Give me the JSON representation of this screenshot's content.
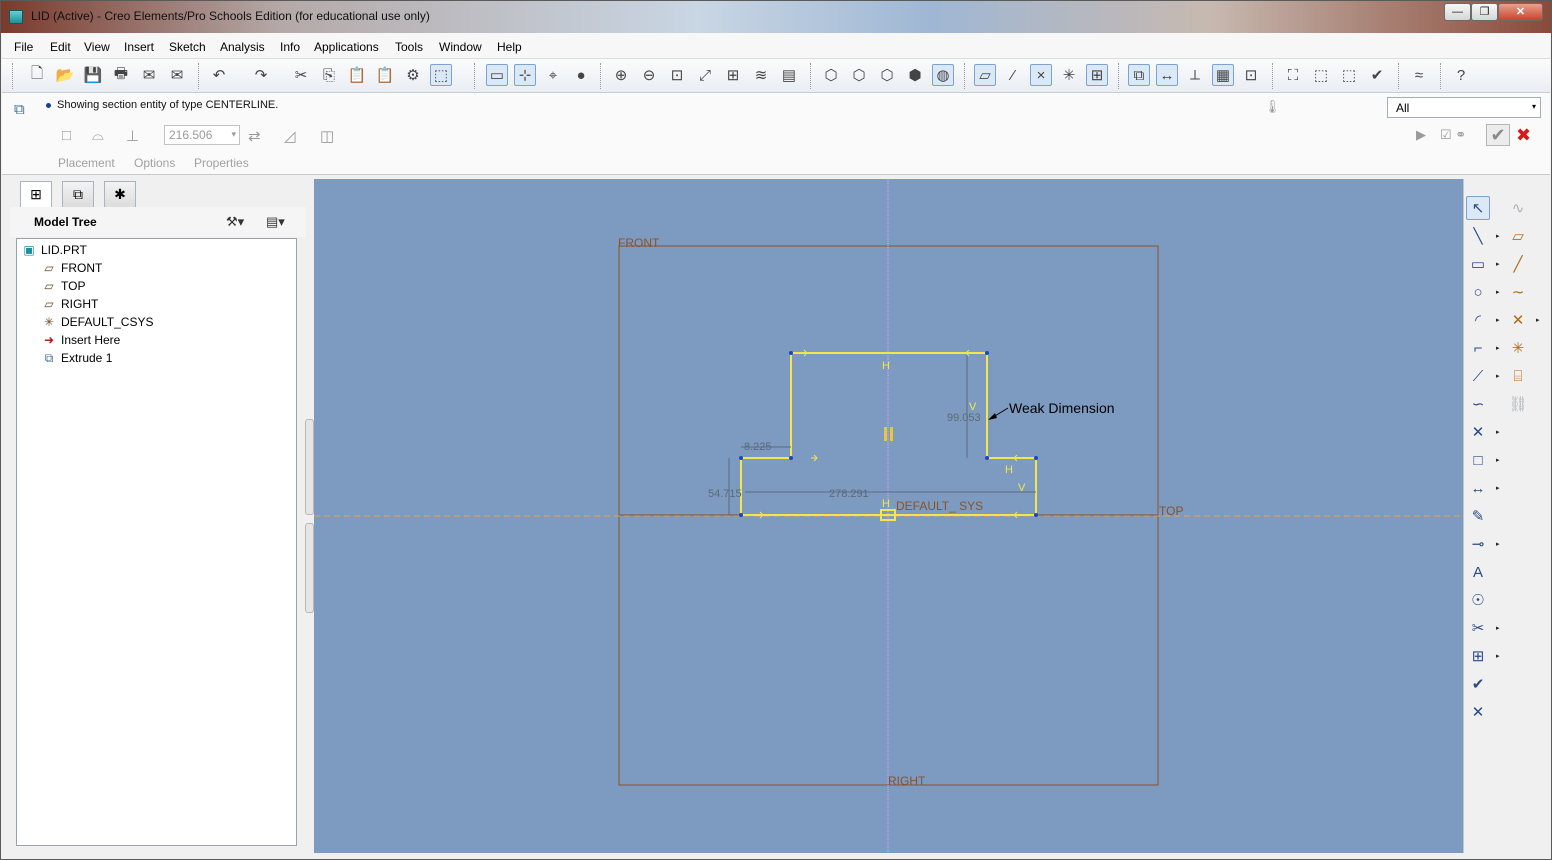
{
  "window": {
    "title": "LID (Active) - Creo Elements/Pro Schools Edition (for educational use only)",
    "min_glyph": "—",
    "max_glyph": "❐",
    "close_glyph": "✕"
  },
  "menu": [
    "File",
    "Edit",
    "View",
    "Insert",
    "Sketch",
    "Analysis",
    "Info",
    "Applications",
    "Tools",
    "Window",
    "Help"
  ],
  "toolbar": {
    "icons": [
      "new-icon",
      "open-icon",
      "save-icon",
      "print-icon",
      "send-mail-icon",
      "mail-link-icon",
      "undo-icon",
      "redo-icon",
      "cut-icon",
      "copy-icon",
      "paste-icon",
      "paste-special-icon",
      "regenerate-icon",
      "select-box-icon",
      "sketch-setup-icon",
      "sketch-references-icon",
      "sketch-view-icon",
      "shading-icon",
      "zoom-in-icon",
      "zoom-out-icon",
      "refit-icon",
      "reorient-icon",
      "saved-views-icon",
      "layers-icon",
      "view-manager-icon",
      "wireframe-icon",
      "hidden-line-icon",
      "no-hidden-icon",
      "shaded-icon",
      "enhanced-realism-icon",
      "datum-planes-icon",
      "datum-axes-icon",
      "datum-points-icon",
      "csys-icon",
      "annotations-icon",
      "sketch-orient-icon",
      "disp-dimensions-icon",
      "disp-constraints-icon",
      "disp-grid-icon",
      "disp-vertices-icon",
      "highlight-open-icon",
      "overlap-geom-icon",
      "shade-closed-icon",
      "feature-requirements-icon",
      "analysis-icon",
      "context-help-icon"
    ],
    "glyphs": [
      "🗋",
      "📂",
      "💾",
      "🖶",
      "✉",
      "✉",
      "↶",
      "↷",
      "✂",
      "⎘",
      "📋",
      "📋",
      "⚙",
      "⬚",
      "▭",
      "⊹",
      "⌖",
      "●",
      "⊕",
      "⊖",
      "⊡",
      "⤢",
      "⊞",
      "≋",
      "▤",
      "⬡",
      "⬡",
      "⬡",
      "⬢",
      "◍",
      "▱",
      "⁄",
      "×",
      "✳",
      "⊞",
      "⧉",
      "↔",
      "⟂",
      "▦",
      "⊡",
      "⛶",
      "⬚",
      "⬚",
      "✔",
      "≈",
      "?"
    ]
  },
  "dashboard": {
    "status_message": "Showing section entity of type CENTERLINE.",
    "depth_value": "216.506",
    "tabs": [
      "Placement",
      "Options",
      "Properties"
    ],
    "filter_value": "All",
    "glyphs": {
      "dash": "⧉",
      "solid": "□",
      "surface": "⌓",
      "depth_type": "⊥",
      "flip": "⇄",
      "thicken": "◿",
      "remove": "◫",
      "dropdown": "▾",
      "pause": "▶",
      "preview": "☑ ⚭",
      "confirm": "✔",
      "cancel": "✖",
      "dash_thermo": "🌡"
    }
  },
  "navigator": {
    "tab_glyphs": [
      "⊞",
      "⧉",
      "✱"
    ],
    "tree_title": "Model Tree",
    "settings_glyph": "⚒▾",
    "columns_glyph": "▤▾",
    "items": [
      {
        "label": "LID.PRT",
        "icon": "part-icon",
        "glyph": "▣"
      },
      {
        "label": "FRONT",
        "icon": "datum-plane-icon",
        "glyph": "▱"
      },
      {
        "label": "TOP",
        "icon": "datum-plane-icon",
        "glyph": "▱"
      },
      {
        "label": "RIGHT",
        "icon": "datum-plane-icon",
        "glyph": "▱"
      },
      {
        "label": "DEFAULT_CSYS",
        "icon": "csys-icon",
        "glyph": "✳"
      },
      {
        "label": "Insert Here",
        "icon": "insert-arrow-icon",
        "glyph": "➜"
      },
      {
        "label": "Extrude 1",
        "icon": "extrude-icon",
        "glyph": "⧉"
      }
    ]
  },
  "sketch": {
    "datum_labels": {
      "front": "FRONT",
      "top": "TOP",
      "right": "RIGHT"
    },
    "csys_label": "DEFAULT_ SYS",
    "dimensions": {
      "d1": "8.225",
      "d2": "54.715",
      "d3": "278.291",
      "d4": "99.053"
    },
    "annotation": "Weak Dimension",
    "constraints": {
      "h_top": "H",
      "v_right": "V",
      "h_step": "H",
      "v_step": "V",
      "h_base": "H"
    }
  },
  "palette": {
    "tools": [
      {
        "icon": "select-icon",
        "glyph": "↖"
      },
      {
        "icon": "disabled-spline-icon",
        "glyph": "∿"
      },
      {
        "icon": "line-icon",
        "glyph": "╲"
      },
      {
        "icon": "sketch-plane-icon",
        "glyph": "▱"
      },
      {
        "icon": "rectangle-icon",
        "glyph": "▭"
      },
      {
        "icon": "centerline-icon",
        "glyph": "╱"
      },
      {
        "icon": "circle-icon",
        "glyph": "○"
      },
      {
        "icon": "spline-icon",
        "glyph": "∼"
      },
      {
        "icon": "arc-icon",
        "glyph": "◜"
      },
      {
        "icon": "point-icon",
        "glyph": "✕"
      },
      {
        "icon": "fillet-icon",
        "glyph": "⌐"
      },
      {
        "icon": "csys-sketch-icon",
        "glyph": "✳"
      },
      {
        "icon": "chamfer-icon",
        "glyph": "⟋"
      },
      {
        "icon": "text-icon",
        "glyph": "⌸"
      },
      {
        "icon": "offset-icon",
        "glyph": "∽"
      },
      {
        "icon": "disabled-chain-icon",
        "glyph": "⛓"
      },
      {
        "icon": "intersect-point-icon",
        "glyph": "✕"
      },
      {
        "icon": "palette-icon",
        "glyph": "□"
      },
      {
        "icon": "dimension-icon",
        "glyph": "↔"
      },
      {
        "icon": "modify-icon",
        "glyph": "✎"
      },
      {
        "icon": "constraint-icon",
        "glyph": "⊸"
      },
      {
        "icon": "text-tool-icon",
        "glyph": "A"
      },
      {
        "icon": "sketcher-palette-icon",
        "glyph": "☉"
      },
      {
        "icon": "trim-icon",
        "glyph": "✂"
      },
      {
        "icon": "mirror-icon",
        "glyph": "⊞"
      },
      {
        "icon": "done-icon",
        "glyph": "✔"
      },
      {
        "icon": "quit-icon",
        "glyph": "✕"
      }
    ],
    "dropdown_glyph": "▸"
  }
}
